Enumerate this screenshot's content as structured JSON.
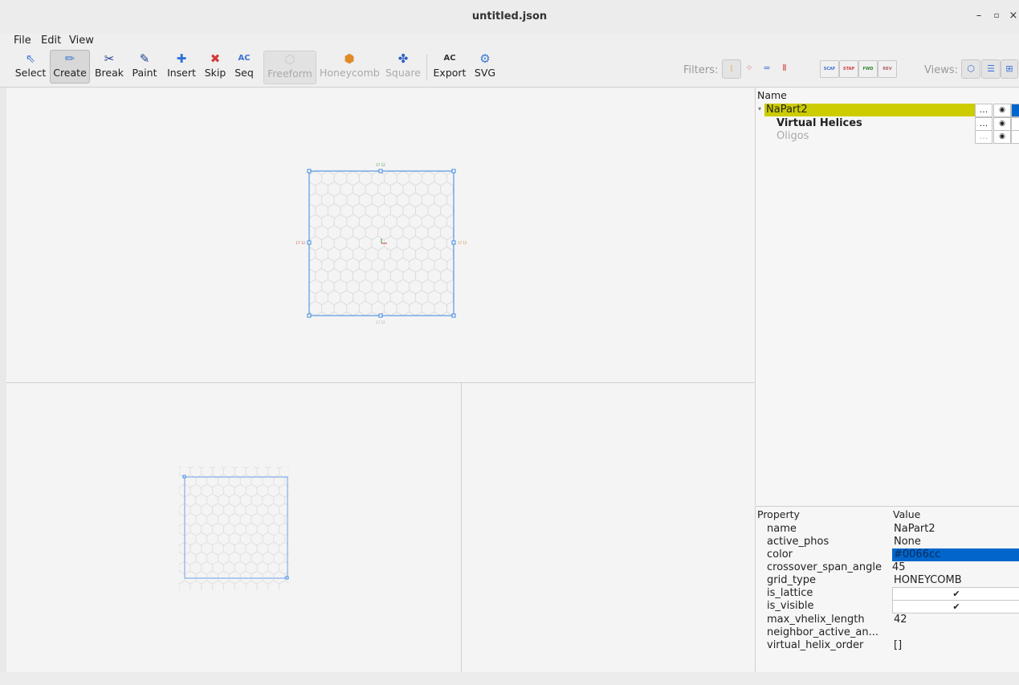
{
  "window": {
    "title": "untitled.json",
    "minimize_glyph": "–",
    "maximize_glyph": "▫",
    "close_glyph": "×"
  },
  "menu": {
    "items": [
      "File",
      "Edit",
      "View"
    ]
  },
  "toolbar": {
    "tools": [
      {
        "label": "Select",
        "icon": "select-arrow-icon",
        "glyph": "⇖",
        "color": "#4a7fd1"
      },
      {
        "label": "Create",
        "icon": "pencil-icon",
        "glyph": "✏",
        "color": "#4a7fd1"
      },
      {
        "label": "Break",
        "icon": "scissors-icon",
        "glyph": "✂",
        "color": "#1f3f8f"
      },
      {
        "label": "Paint",
        "icon": "paintbrush-icon",
        "glyph": "🖌",
        "color": "#1f3f8f"
      },
      {
        "label": "Insert",
        "icon": "plus-icon",
        "glyph": "✚",
        "color": "#2f6fd6"
      },
      {
        "label": "Skip",
        "icon": "x-mark-icon",
        "glyph": "✖",
        "color": "#d23b3b"
      },
      {
        "label": "Seq",
        "icon": "sequence-icon",
        "glyph": "AC",
        "color": "#3b6fd6"
      },
      {
        "label": "Freeform",
        "icon": "freeform-grid-icon",
        "glyph": "⬡",
        "color": "#b8b8b8"
      },
      {
        "label": "Honeycomb",
        "icon": "honeycomb-icon",
        "glyph": "⬢",
        "color": "#e08a2a"
      },
      {
        "label": "Square",
        "icon": "square-lattice-icon",
        "glyph": "✤",
        "color": "#2f5fc0"
      },
      {
        "label": "Export",
        "icon": "export-sequence-icon",
        "glyph": "AC",
        "color": "#333333"
      },
      {
        "label": "SVG",
        "icon": "svg-export-icon",
        "glyph": "⚙",
        "color": "#3a7ad6"
      }
    ],
    "filters_label": "Filters:",
    "views_label": "Views:",
    "filter_strand_types": [
      "SCAF",
      "STAP",
      "FWD",
      "REV"
    ]
  },
  "tree": {
    "header": "Name",
    "rows": [
      {
        "name": "NaPart2",
        "dots": "...",
        "selected": true
      },
      {
        "name": "Virtual Helices",
        "dots": "..."
      },
      {
        "name": "Oligos",
        "dots": "..."
      }
    ],
    "part_color": "#0066cc",
    "highlight_color": "#cccc00"
  },
  "properties": {
    "header_property": "Property",
    "header_value": "Value",
    "rows": [
      {
        "key": "name",
        "value": "NaPart2"
      },
      {
        "key": "active_phos",
        "value": "None"
      },
      {
        "key": "color",
        "value": "#0066cc"
      },
      {
        "key": "crossover_span_angle",
        "value": "45"
      },
      {
        "key": "grid_type",
        "value": "HONEYCOMB"
      },
      {
        "key": "is_lattice",
        "value": "✔"
      },
      {
        "key": "is_visible",
        "value": "✔"
      },
      {
        "key": "max_vhelix_length",
        "value": "42"
      },
      {
        "key": "neighbor_active_an...",
        "value": ""
      },
      {
        "key": "virtual_helix_order",
        "value": "[]"
      }
    ]
  },
  "slice_view": {
    "dimension_label": "17 12"
  }
}
